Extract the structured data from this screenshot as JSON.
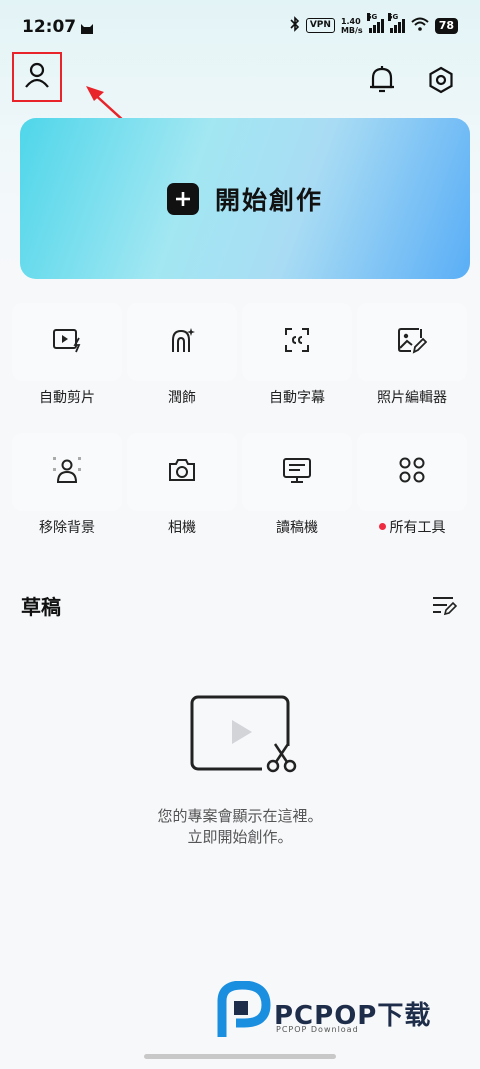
{
  "status_bar": {
    "time": "12:07",
    "vpn": "VPN",
    "speed_value": "1.40",
    "speed_unit": "MB/s",
    "network_1": "5G",
    "network_2": "5G",
    "battery": "78"
  },
  "header": {
    "profile_icon": "person-icon",
    "notification_icon": "bell-icon",
    "settings_icon": "hexagon-gear-icon"
  },
  "create": {
    "label": "開始創作",
    "icon": "plus-icon"
  },
  "tools": [
    {
      "label": "自動剪片",
      "icon": "auto-cut-icon",
      "dot": false
    },
    {
      "label": "潤飾",
      "icon": "retouch-icon",
      "dot": false
    },
    {
      "label": "自動字幕",
      "icon": "captions-icon",
      "dot": false
    },
    {
      "label": "照片編輯器",
      "icon": "photo-edit-icon",
      "dot": false
    },
    {
      "label": "移除背景",
      "icon": "remove-bg-icon",
      "dot": false
    },
    {
      "label": "相機",
      "icon": "camera-icon",
      "dot": false
    },
    {
      "label": "讀稿機",
      "icon": "teleprompter-icon",
      "dot": false
    },
    {
      "label": "所有工具",
      "icon": "grid-icon",
      "dot": true
    }
  ],
  "drafts": {
    "title": "草稿",
    "empty_line1": "您的專案會顯示在這裡。",
    "empty_line2": "立即開始創作。"
  },
  "watermark": {
    "text": "PCPOP下载",
    "sub": "PCPOP Download"
  },
  "colors": {
    "highlight": "#e8232a",
    "dot": "#ee2b40",
    "card_start": "#4fd6ea",
    "card_end": "#5aaef6"
  }
}
